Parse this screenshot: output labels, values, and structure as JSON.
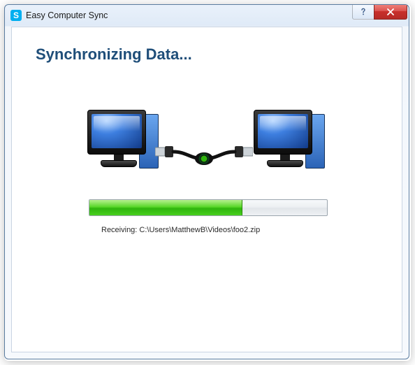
{
  "window": {
    "title": "Easy Computer Sync",
    "app_icon_letter": "S"
  },
  "heading": "Synchronizing Data...",
  "progress": {
    "percent": 64
  },
  "status": {
    "prefix": "Receiving: ",
    "path": "C:\\Users\\MatthewB\\Videos\\foo2.zip"
  },
  "colors": {
    "heading": "#1f4e79",
    "progress_green": "#2fb50d",
    "close_red": "#c9302c"
  }
}
